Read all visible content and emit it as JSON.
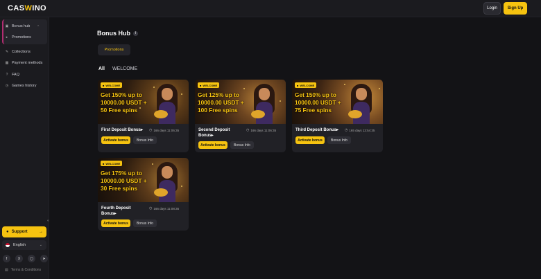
{
  "brand": {
    "logo_pre": "CAS",
    "logo_w": "W",
    "logo_post": "INO"
  },
  "header": {
    "login_label": "Login",
    "signup_label": "Sign Up"
  },
  "sidebar": {
    "items": [
      {
        "label": "Bonus hub",
        "icon": "gift-icon"
      },
      {
        "label": "Promotions",
        "icon": "megaphone-icon"
      },
      {
        "label": "Collections",
        "icon": "collections-icon"
      },
      {
        "label": "Payment methods",
        "icon": "card-icon"
      },
      {
        "label": "FAQ",
        "icon": "question-icon"
      },
      {
        "label": "Games history",
        "icon": "history-icon"
      }
    ],
    "support_label": "Support",
    "language_label": "English",
    "terms_label": "Terms & Conditions"
  },
  "main": {
    "title": "Bonus Hub",
    "tab_label": "Promotions",
    "filters": [
      "All",
      "WELCOME"
    ]
  },
  "cards": [
    {
      "badge": "WELCOME",
      "offer_line1": "Get 150% up to",
      "offer_line2": "10000.00 USDT +",
      "offer_line3": "50 Free spins",
      "title": "First Deposit Bonus",
      "timer": "166 days 11:06:35",
      "activate_label": "Activate bonus",
      "info_label": "Bonus Info"
    },
    {
      "badge": "WELCOME",
      "offer_line1": "Get 125% up to",
      "offer_line2": "10000.00 USDT +",
      "offer_line3": "100 Free spins",
      "title": "Second Deposit Bonus",
      "timer": "166 days 11:06:35",
      "activate_label": "Activate bonus",
      "info_label": "Bonus Info"
    },
    {
      "badge": "WELCOME",
      "offer_line1": "Get 150% up to",
      "offer_line2": "10000.00 USDT +",
      "offer_line3": "75 Free spins",
      "title": "Third Deposit Bonus",
      "timer": "165 days 13:54:35",
      "activate_label": "Activate bonus",
      "info_label": "Bonus Info"
    },
    {
      "badge": "WELCOME",
      "offer_line1": "Get 175% up to",
      "offer_line2": "10000.00 USDT +",
      "offer_line3": "30 Free spins",
      "title": "Fourth Deposit Bonus",
      "timer": "166 days 11:08:35",
      "activate_label": "Activate bonus",
      "info_label": "Bonus Info"
    }
  ],
  "colors": {
    "accent": "#f6c310",
    "background": "#131316",
    "panel": "#1b1b1f",
    "card": "#212126"
  }
}
